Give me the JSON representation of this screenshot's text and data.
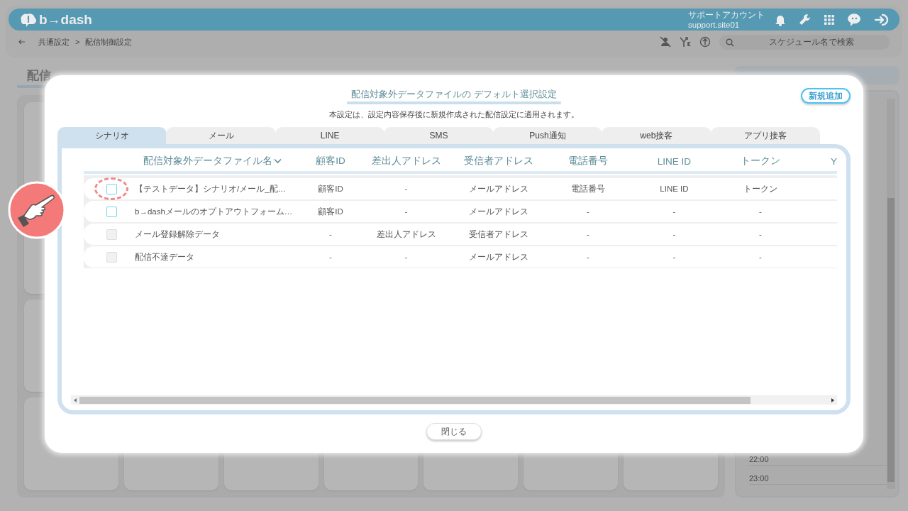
{
  "header": {
    "logo": "b→dash",
    "account_label": "サポートアカウント",
    "account_id": "support.site01"
  },
  "breadcrumb": {
    "items": [
      "共通設定",
      "配信制御設定"
    ],
    "separator": ">"
  },
  "search": {
    "placeholder": "スケジュール名で検索"
  },
  "page_title": "配信",
  "calendar_times": [
    "22:00",
    "23:00"
  ],
  "modal": {
    "title": "配信対象外データファイルの デフォルト選択設定",
    "note": "本設定は、設定内容保存後に新規作成された配信設定に適用されます。",
    "add_button": "新規追加",
    "tabs": [
      {
        "label": "シナリオ",
        "selected": true
      },
      {
        "label": "メール",
        "selected": false
      },
      {
        "label": "LINE",
        "selected": false
      },
      {
        "label": "SMS",
        "selected": false
      },
      {
        "label": "Push通知",
        "selected": false
      },
      {
        "label": "web接客",
        "selected": false
      },
      {
        "label": "アプリ接客",
        "selected": false
      }
    ],
    "table": {
      "columns": [
        "配信対象外データファイル名",
        "顧客ID",
        "差出人アドレス",
        "受信者アドレス",
        "電話番号",
        "LINE ID",
        "トークン",
        "Y"
      ],
      "rows": [
        {
          "checked": false,
          "disabled": false,
          "highlighted": true,
          "cells": [
            "【テストデータ】シナリオ/メール_配…",
            "顧客ID",
            "-",
            "メールアドレス",
            "電話番号",
            "LINE ID",
            "トークン"
          ]
        },
        {
          "checked": false,
          "disabled": false,
          "highlighted": false,
          "cells": [
            "b→dashメールのオプトアウトフォーム…",
            "顧客ID",
            "-",
            "メールアドレス",
            "-",
            "-",
            "-"
          ]
        },
        {
          "checked": false,
          "disabled": true,
          "highlighted": false,
          "cells": [
            "メール登録解除データ",
            "-",
            "差出人アドレス",
            "受信者アドレス",
            "-",
            "-",
            "-"
          ]
        },
        {
          "checked": false,
          "disabled": true,
          "highlighted": false,
          "cells": [
            "配信不達データ",
            "-",
            "-",
            "メールアドレス",
            "-",
            "-",
            "-"
          ]
        }
      ]
    },
    "close_button": "閉じる"
  }
}
